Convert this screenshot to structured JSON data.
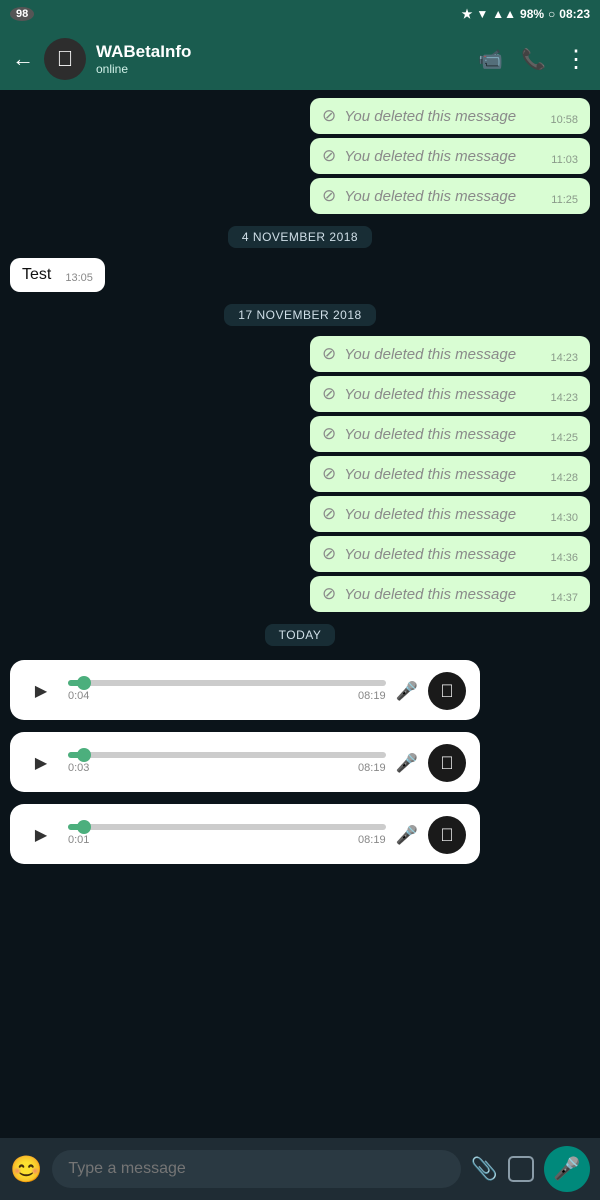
{
  "statusBar": {
    "leftIcon": "98",
    "battery": "98%",
    "time": "08:23"
  },
  "header": {
    "contactName": "WABetaInfo",
    "status": "online",
    "backLabel": "←",
    "videoCallIcon": "📹",
    "callIcon": "📞",
    "menuIcon": "⋮"
  },
  "chat": {
    "deletedMessages_top": [
      {
        "text": "You deleted this message",
        "time": "10:58"
      },
      {
        "text": "You deleted this message",
        "time": "11:03"
      },
      {
        "text": "You deleted this message",
        "time": "11:25"
      }
    ],
    "dateSep1": "4 NOVEMBER 2018",
    "testMessage": {
      "text": "Test",
      "time": "13:05"
    },
    "dateSep2": "17 NOVEMBER 2018",
    "deletedMessages_nov": [
      {
        "text": "You deleted this message",
        "time": "14:23"
      },
      {
        "text": "You deleted this message",
        "time": "14:23"
      },
      {
        "text": "You deleted this message",
        "time": "14:25"
      },
      {
        "text": "You deleted this message",
        "time": "14:28"
      },
      {
        "text": "You deleted this message",
        "time": "14:30"
      },
      {
        "text": "You deleted this message",
        "time": "14:36"
      },
      {
        "text": "You deleted this message",
        "time": "14:37"
      }
    ],
    "dateSep3": "TODAY",
    "audioMessages": [
      {
        "duration": "0:04",
        "time": "08:19",
        "fillPct": 5
      },
      {
        "duration": "0:03",
        "time": "08:19",
        "fillPct": 5
      },
      {
        "duration": "0:01",
        "time": "08:19",
        "fillPct": 5
      }
    ]
  },
  "bottomBar": {
    "placeholder": "Type a message"
  },
  "icons": {
    "deleted": "🚫",
    "play": "▶",
    "mic": "🎤",
    "emoji": "😊",
    "attach": "📎",
    "camera": "⬜",
    "micBtn": "🎤"
  }
}
